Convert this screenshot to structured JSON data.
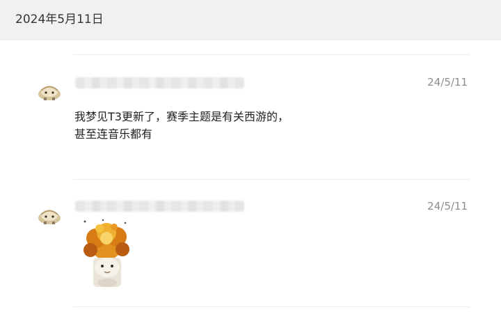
{
  "date_header": "2024年5月11日",
  "messages": [
    {
      "time": "24/5/11",
      "lines": [
        "我梦见T3更新了，赛季主题是有关西游的，",
        "甚至连音乐都有"
      ]
    },
    {
      "time": "24/5/11",
      "sticker": "burning-cat-sticker"
    }
  ],
  "colors": {
    "header_bg": "#f1f1f1",
    "divider": "#ececec",
    "timestamp": "#8c8c8c",
    "text": "#222222"
  }
}
